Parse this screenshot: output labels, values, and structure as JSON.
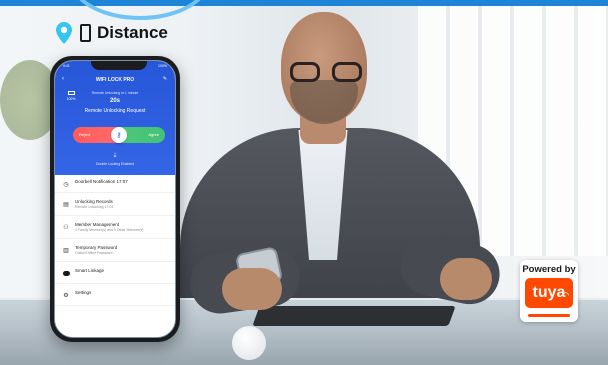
{
  "headline": {
    "text": "Distance"
  },
  "phone": {
    "status_left": "9:41",
    "status_right": "100%",
    "title": "WIFI LOCK PRO",
    "battery_label": "100%",
    "bluetooth_line": "Remote Unlocking in 1 minute",
    "countdown": "20s",
    "remote_title": "Remote Unlocking Request",
    "reject_label": "Reject",
    "agree_label": "Agree",
    "enabled_line": "Double Locking Enabled",
    "list": [
      {
        "icon": "clock-icon",
        "title": "Doorbell Notification 17:07",
        "subtitle": ""
      },
      {
        "icon": "record-icon",
        "title": "Unlocking Records",
        "subtitle": "Remote Unlocking 17:04"
      },
      {
        "icon": "member-icon",
        "title": "Member Management",
        "subtitle": "1 Family Member(s) and 0 Other Member(s)"
      },
      {
        "icon": "password-icon",
        "title": "Temporary Password",
        "subtitle": "Online/Offline Password"
      },
      {
        "icon": "linkage-icon",
        "title": "Smart Linkage",
        "subtitle": ""
      },
      {
        "icon": "settings-icon",
        "title": "Settings",
        "subtitle": ""
      }
    ]
  },
  "badge": {
    "powered_by": "Powered by",
    "brand": "tuya"
  },
  "colors": {
    "app_blue": "#2f5fe0",
    "reject_red": "#ff5a5a",
    "agree_green": "#45c276",
    "tuya_orange": "#ff4800",
    "pin_cyan": "#34c6f0"
  }
}
